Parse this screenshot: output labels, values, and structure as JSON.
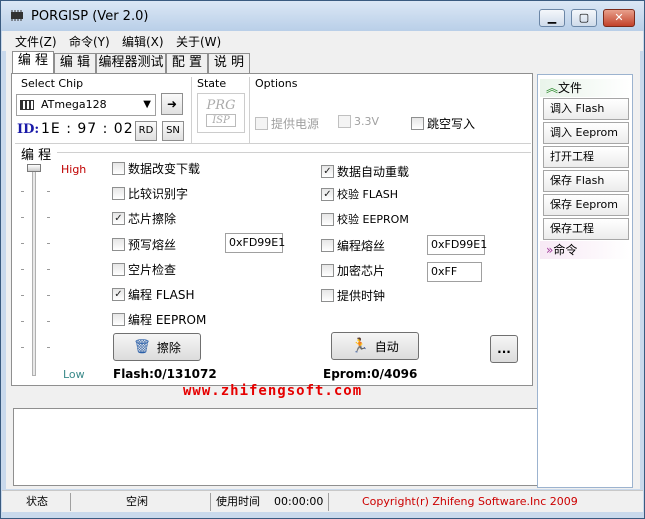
{
  "window": {
    "title": "PORGISP (Ver 2.0)"
  },
  "menu": [
    "文件(Z)",
    "命令(Y)",
    "编辑(X)",
    "关于(W)"
  ],
  "tabs": [
    "编 程",
    "编 辑",
    "编程器测试",
    "配 置",
    "说 明"
  ],
  "chip": {
    "group_label": "Select Chip",
    "selected": "ATmega128",
    "id_label": "ID:",
    "id_value": "1E : 97 : 02",
    "rd_label": "RD",
    "sn_label": "SN"
  },
  "state": {
    "group_label": "State",
    "logo_top": "PRG",
    "logo_bottom": "ISP"
  },
  "options": {
    "group_label": "Options",
    "power": {
      "label": "提供电源",
      "checked": false,
      "disabled": true
    },
    "voltage": {
      "label": "3.3V",
      "checked": false,
      "disabled": true
    },
    "skip_empty": {
      "label": "跳空写入",
      "checked": false
    }
  },
  "program": {
    "group_label": "编 程",
    "high_label": "High",
    "low_label": "Low",
    "left_checks": [
      {
        "label": "数据改变下载",
        "checked": false
      },
      {
        "label": "比较识别字",
        "checked": false
      },
      {
        "label": "芯片擦除",
        "checked": true
      },
      {
        "label": "预写熔丝",
        "checked": false
      },
      {
        "label": "空片检查",
        "checked": false
      },
      {
        "label": "编程 FLASH",
        "checked": true
      },
      {
        "label": "编程 EEPROM",
        "checked": false
      }
    ],
    "right_checks": [
      {
        "label": "数据自动重载",
        "checked": true
      },
      {
        "label": "校验 FLASH",
        "checked": true
      },
      {
        "label": "校验 EEPROM",
        "checked": false
      },
      {
        "label": "编程熔丝",
        "checked": false
      },
      {
        "label": "加密芯片",
        "checked": false
      },
      {
        "label": "提供时钟",
        "checked": false
      }
    ],
    "prewrite_fuse_value": "0xFD99E1",
    "program_fuse_value": "0xFD99E1",
    "encrypt_value": "0xFF",
    "erase_label": "擦除",
    "auto_label": "自动",
    "more_label": "...",
    "flash_status": "Flash:0/131072",
    "eeprom_status": "Eprom:0/4096",
    "slider_level": 1.0
  },
  "website": "www.zhifengsoft.com",
  "side": {
    "file_header": "文件",
    "buttons": [
      "调入 Flash",
      "调入 Eeprom",
      "打开工程",
      "保存 Flash",
      "保存 Eeprom",
      "保存工程"
    ],
    "cmd_header": "命令"
  },
  "status": {
    "state_label": "状态",
    "state_value": "空闲",
    "time_label": "使用时间",
    "time_value": "00:00:00",
    "copyright": "Copyright(r) Zhifeng Software.Inc 2009"
  },
  "colors": {
    "accent_red": "#e60000",
    "id_blue": "#1a1aa8",
    "copyright_red": "#cc0000"
  }
}
